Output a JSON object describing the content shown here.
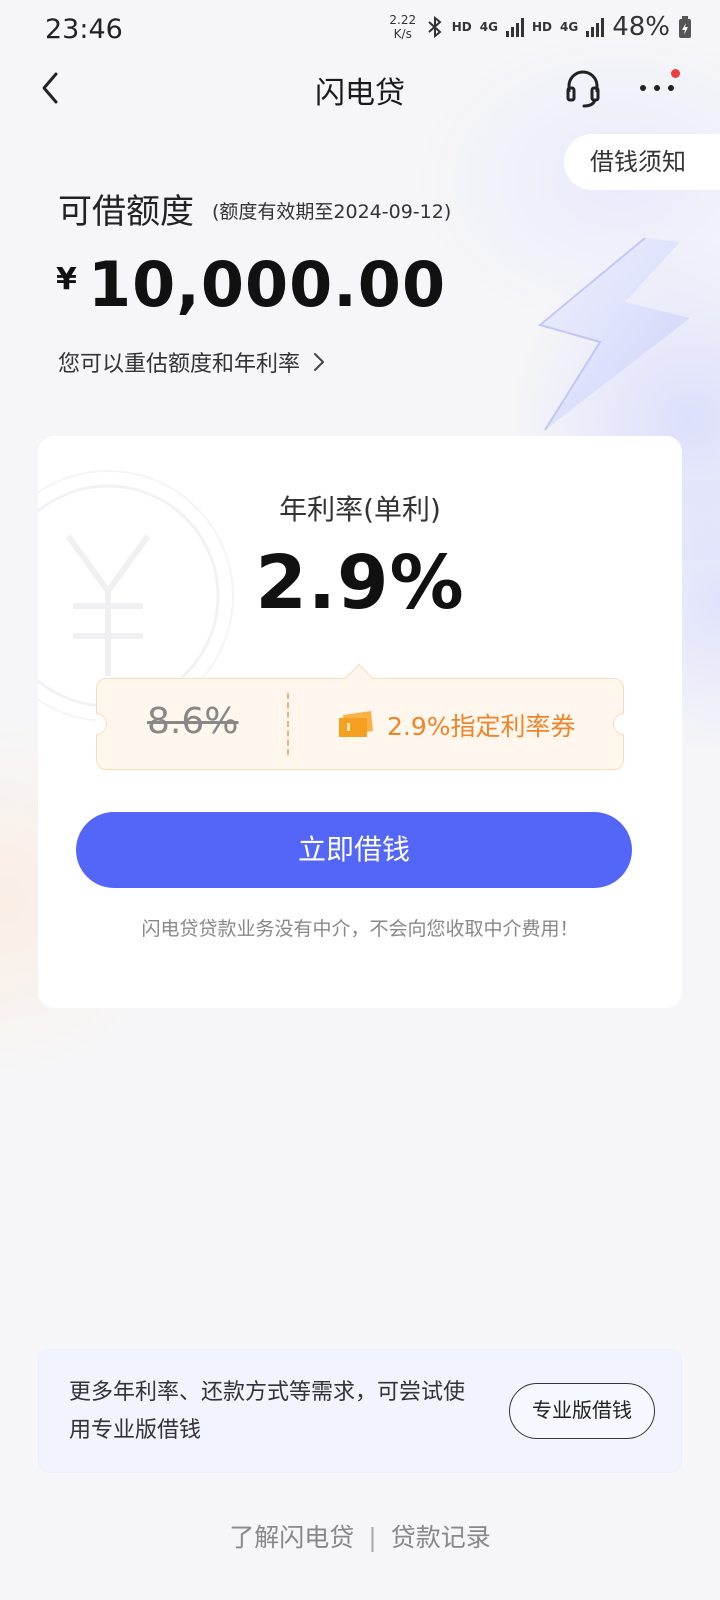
{
  "status_bar": {
    "time": "23:46",
    "net_speed_value": "2.22",
    "net_speed_unit": "K/s",
    "hd1": "HD",
    "hd2": "HD",
    "sig1": "4G",
    "sig2": "4G",
    "battery": "48%"
  },
  "nav": {
    "title": "闪电贷",
    "has_notification": true
  },
  "notice_label": "借钱须知",
  "credit": {
    "label": "可借额度",
    "validity": "(额度有效期至2024-09-12)",
    "currency": "¥",
    "amount": "10,000.00",
    "reassess_link": "您可以重估额度和年利率"
  },
  "rate": {
    "label": "年利率(单利)",
    "value": "2.9%"
  },
  "coupon": {
    "original_rate": "8.6%",
    "text": "2.9%指定利率券"
  },
  "borrow_button": "立即借钱",
  "disclaimer": "闪电贷贷款业务没有中介，不会向您收取中介费用！",
  "pro": {
    "text": "更多年利率、还款方式等需求，可尝试使用专业版借钱",
    "button": "专业版借钱"
  },
  "footer": {
    "learn": "了解闪电贷",
    "separator": "|",
    "records": "贷款记录"
  },
  "colors": {
    "primary": "#5466f7",
    "coupon_accent": "#f08428",
    "notification_dot": "#ee3b3b"
  },
  "icons": [
    "back-arrow-icon",
    "headset-icon",
    "more-dots-icon",
    "chevron-right-icon",
    "ticket-icon",
    "lightning-bolt-icon",
    "yen-watermark-icon"
  ]
}
